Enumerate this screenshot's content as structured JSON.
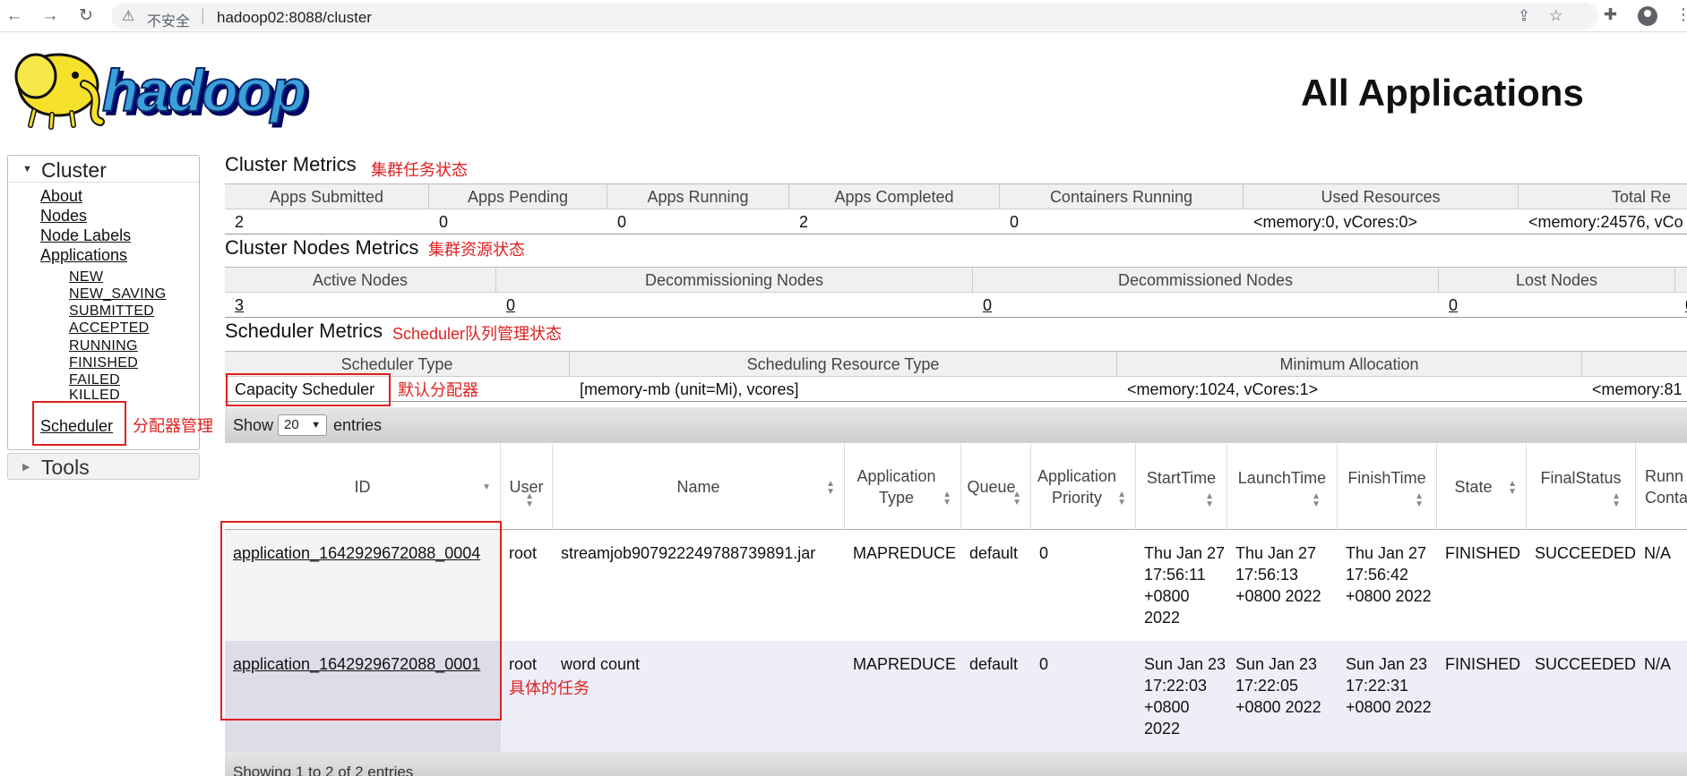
{
  "browser": {
    "security_label": "不安全",
    "separator": "|",
    "url": "hadoop02:8088/cluster"
  },
  "header": {
    "logo_text": "hadoop",
    "title": "All Applications"
  },
  "sidebar": {
    "cluster_title": "Cluster",
    "links": [
      "About",
      "Nodes",
      "Node Labels",
      "Applications"
    ],
    "app_states": [
      "NEW",
      "NEW_SAVING",
      "SUBMITTED",
      "ACCEPTED",
      "RUNNING",
      "FINISHED",
      "FAILED",
      "KILLED"
    ],
    "scheduler_link": "Scheduler",
    "tools_title": "Tools"
  },
  "annotations": {
    "cluster_metrics": "集群任务状态",
    "nodes_metrics": "集群资源状态",
    "scheduler_metrics": "Scheduler队列管理状态",
    "default_scheduler": "默认分配器",
    "scheduler_management": "分配器管理",
    "specific_tasks": "具体的任务"
  },
  "cluster_metrics": {
    "title": "Cluster Metrics",
    "headers": [
      "Apps Submitted",
      "Apps Pending",
      "Apps Running",
      "Apps Completed",
      "Containers Running",
      "Used Resources",
      "Total Re"
    ],
    "values": [
      "2",
      "0",
      "0",
      "2",
      "0",
      "<memory:0, vCores:0>",
      "<memory:24576, vCo"
    ]
  },
  "nodes_metrics": {
    "title": "Cluster Nodes Metrics",
    "headers": [
      "Active Nodes",
      "Decommissioning Nodes",
      "Decommissioned Nodes",
      "Lost Nodes"
    ],
    "values": [
      "3",
      "0",
      "0",
      "0",
      "0"
    ]
  },
  "scheduler_metrics": {
    "title": "Scheduler Metrics",
    "headers": [
      "Scheduler Type",
      "Scheduling Resource Type",
      "Minimum Allocation"
    ],
    "values": [
      "Capacity Scheduler",
      "[memory-mb (unit=Mi), vcores]",
      "<memory:1024, vCores:1>",
      "<memory:81"
    ]
  },
  "apps_table": {
    "show_label": "Show",
    "entries_value": "20",
    "entries_label": "entries",
    "columns": [
      "ID",
      "User",
      "Name",
      "Application Type",
      "Queue",
      "Application Priority",
      "StartTime",
      "LaunchTime",
      "FinishTime",
      "State",
      "FinalStatus",
      "Runn Conta"
    ],
    "rows": [
      {
        "id": "application_1642929672088_0004",
        "user": "root",
        "name": "streamjob907922249788739891.jar",
        "type": "MAPREDUCE",
        "queue": "default",
        "priority": "0",
        "start": "Thu Jan 27 17:56:11 +0800 2022",
        "launch": "Thu Jan 27 17:56:13 +0800 2022",
        "finish": "Thu Jan 27 17:56:42 +0800 2022",
        "state": "FINISHED",
        "final_status": "SUCCEEDED",
        "running": "N/A"
      },
      {
        "id": "application_1642929672088_0001",
        "user": "root",
        "name": "word count",
        "type": "MAPREDUCE",
        "queue": "default",
        "priority": "0",
        "start": "Sun Jan 23 17:22:03 +0800 2022",
        "launch": "Sun Jan 23 17:22:05 +0800 2022",
        "finish": "Sun Jan 23 17:22:31 +0800 2022",
        "state": "FINISHED",
        "final_status": "SUCCEEDED",
        "running": "N/A"
      }
    ],
    "footer": "Showing 1 to 2 of 2 entries"
  }
}
